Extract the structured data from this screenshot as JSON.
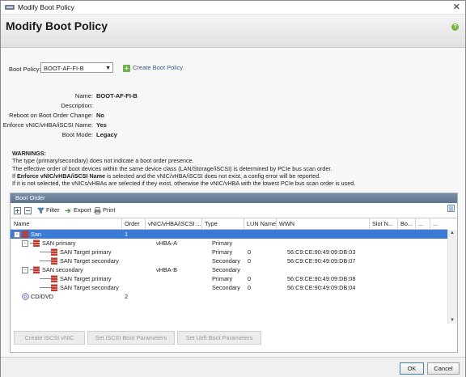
{
  "window": {
    "title": "Modify Boot Policy"
  },
  "header": {
    "title": "Modify Boot Policy"
  },
  "boot_policy": {
    "label": "Boot Policy:",
    "selected": "BOOT-AF-FI-B",
    "create_link": "Create Boot Policy"
  },
  "props": {
    "name_k": "Name:",
    "name_v": "BOOT-AF-FI-B",
    "desc_k": "Description:",
    "desc_v": "",
    "reboot_k": "Reboot on Boot Order Change:",
    "reboot_v": "No",
    "enforce_k": "Enforce vNIC/vHBA/iSCSI Name:",
    "enforce_v": "Yes",
    "mode_k": "Boot Mode:",
    "mode_v": "Legacy"
  },
  "warnings": {
    "title": "WARNINGS:",
    "l1": "The type (primary/secondary) does not indicate a boot order presence.",
    "l2": "The effective order of boot devices within the same device class (LAN/Storage/iSCSI) is determined by PCIe bus scan order.",
    "l3_pre": "If ",
    "l3_bold": "Enforce vNIC/vHBA/iSCSI Name",
    "l3_post": " is selected and the vNIC/vHBA/iSCSI does not exist, a config error will be reported.",
    "l4": "If it is not selected, the vNICs/vHBAs are selected if they exist, otherwise the vNIC/vHBA with the lowest PCIe bus scan order is used."
  },
  "boot_order": {
    "title": "Boot Order",
    "toolbar": {
      "filter": "Filter",
      "export": "Export",
      "print": "Print"
    },
    "columns": {
      "name": "Name",
      "order": "Order",
      "vnic": "vNIC/vHBA/iSCSI ...",
      "type": "Type",
      "lun": "LUN Name",
      "wwn": "WWN",
      "slot": "Slot N...",
      "bo": "Bo...",
      "c1": "...",
      "c2": "..."
    },
    "rows": [
      {
        "name": "San",
        "order": "1",
        "vnic": "",
        "type": "",
        "lun": "",
        "wwn": ""
      },
      {
        "name": "SAN primary",
        "order": "",
        "vnic": "vHBA-A",
        "type": "Primary",
        "lun": "",
        "wwn": ""
      },
      {
        "name": "SAN Target primary",
        "order": "",
        "vnic": "",
        "type": "Primary",
        "lun": "0",
        "wwn": "56:C9:CE:90:49:09:DB:03"
      },
      {
        "name": "SAN Target secondary",
        "order": "",
        "vnic": "",
        "type": "Secondary",
        "lun": "0",
        "wwn": "56:C9:CE:90:49:09:DB:07"
      },
      {
        "name": "SAN secondary",
        "order": "",
        "vnic": "vHBA-B",
        "type": "Secondary",
        "lun": "",
        "wwn": ""
      },
      {
        "name": "SAN Target primary",
        "order": "",
        "vnic": "",
        "type": "Primary",
        "lun": "0",
        "wwn": "56:C9:CE:90:49:09:DB:08"
      },
      {
        "name": "SAN Target secondary",
        "order": "",
        "vnic": "",
        "type": "Secondary",
        "lun": "0",
        "wwn": "56:C9:CE:90:49:09:DB:04"
      },
      {
        "name": "CD/DVD",
        "order": "2",
        "vnic": "",
        "type": "",
        "lun": "",
        "wwn": ""
      }
    ],
    "buttons": {
      "create_iscsi": "Create iSCSI vNIC",
      "set_iscsi": "Set iSCSI Boot Parameters",
      "set_uefi": "Set Uefi Boot Parameters"
    }
  },
  "footer": {
    "ok": "OK",
    "cancel": "Cancel"
  }
}
